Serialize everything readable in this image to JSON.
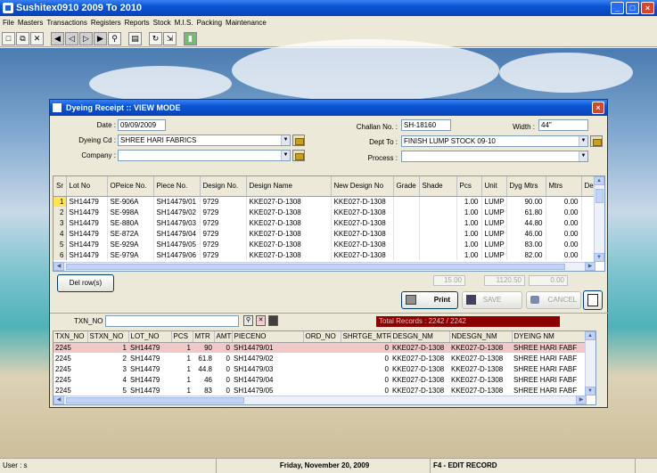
{
  "app": {
    "title": "Sushitex0910     2009  To  2010",
    "menus": [
      "File",
      "Masters",
      "Transactions",
      "Registers",
      "Reports",
      "Stock",
      "M.I.S.",
      "Packing",
      "Maintenance"
    ]
  },
  "toolbar": [
    "new-icon",
    "copy-icon",
    "delete-icon",
    "first-record-icon",
    "prev-record-icon",
    "next-record-icon",
    "last-record-icon",
    "search-icon",
    "print-icon",
    "refresh-icon",
    "export-icon",
    "exit-icon"
  ],
  "dialog": {
    "title": "Dyeing Receipt :: VIEW MODE",
    "date_label": "Date :",
    "date_value": "09/09/2009",
    "dyeing_cd_label": "Dyeing Cd :",
    "dyeing_cd_value": "SHREE HARI FABRICS",
    "company_label": "Company :",
    "company_value": "",
    "challan_label": "Challan No. :",
    "challan_value": "SH-18160",
    "width_label": "Width :",
    "width_value": "44\"",
    "dept_label": "Dept To :",
    "dept_value": "FINISH LUMP STOCK 09-10",
    "process_label": "Process :",
    "process_value": ""
  },
  "grid1": {
    "columns": [
      "Sr",
      "Lot No",
      "OPeice No.",
      "Piece No.",
      "Design No.",
      "Design Name",
      "New Design No",
      "Grade",
      "Shade",
      "Pcs",
      "Unit",
      "Dyg Mtrs",
      "Mtrs",
      "De"
    ],
    "rows": [
      [
        "1",
        "SH14479",
        "SE-906A",
        "SH14479/01",
        "9729",
        "KKE027-D-1308",
        "KKE027-D-1308",
        "",
        "",
        "1.00",
        "LUMP",
        "90.00",
        "0.00",
        ""
      ],
      [
        "2",
        "SH14479",
        "SE-998A",
        "SH14479/02",
        "9729",
        "KKE027-D-1308",
        "KKE027-D-1308",
        "",
        "",
        "1.00",
        "LUMP",
        "61.80",
        "0.00",
        ""
      ],
      [
        "3",
        "SH14479",
        "SE-880A",
        "SH14479/03",
        "9729",
        "KKE027-D-1308",
        "KKE027-D-1308",
        "",
        "",
        "1.00",
        "LUMP",
        "44.80",
        "0.00",
        ""
      ],
      [
        "4",
        "SH14479",
        "SE-872A",
        "SH14479/04",
        "9729",
        "KKE027-D-1308",
        "KKE027-D-1308",
        "",
        "",
        "1.00",
        "LUMP",
        "46.00",
        "0.00",
        ""
      ],
      [
        "5",
        "SH14479",
        "SE-929A",
        "SH14479/05",
        "9729",
        "KKE027-D-1308",
        "KKE027-D-1308",
        "",
        "",
        "1.00",
        "LUMP",
        "83.00",
        "0.00",
        ""
      ],
      [
        "6",
        "SH14479",
        "SE-979A",
        "SH14479/06",
        "9729",
        "KKE027-D-1308",
        "KKE027-D-1308",
        "",
        "",
        "1.00",
        "LUMP",
        "82.00",
        "0.00",
        ""
      ]
    ]
  },
  "totals": {
    "pcs": "15.00",
    "dyg_mtrs": "1120.50",
    "mtrs": "0.00"
  },
  "buttons": {
    "del_rows": "Del row(s)",
    "print": "Print",
    "save": "SAVE",
    "cancel": "CANCEL"
  },
  "search": {
    "label": "TXN_NO",
    "value": "",
    "total_records": "Total Records : 2242 / 2242"
  },
  "grid2": {
    "columns": [
      "TXN_NO",
      "STXN_NO",
      "LOT_NO",
      "PCS",
      "MTR",
      "AMT",
      "PIECENO",
      "ORD_NO",
      "SHRTGE_MTR",
      "DESGN_NM",
      "NDESGN_NM",
      "DYEING NM"
    ],
    "rows": [
      [
        "2245",
        "1",
        "SH14479",
        "1",
        "90",
        "0",
        "SH14479/01",
        "",
        "0",
        "KKE027-D-1308",
        "KKE027-D-1308",
        "SHREE HARI FABF"
      ],
      [
        "2245",
        "2",
        "SH14479",
        "1",
        "61.8",
        "0",
        "SH14479/02",
        "",
        "0",
        "KKE027-D-1308",
        "KKE027-D-1308",
        "SHREE HARI FABF"
      ],
      [
        "2245",
        "3",
        "SH14479",
        "1",
        "44.8",
        "0",
        "SH14479/03",
        "",
        "0",
        "KKE027-D-1308",
        "KKE027-D-1308",
        "SHREE HARI FABF"
      ],
      [
        "2245",
        "4",
        "SH14479",
        "1",
        "46",
        "0",
        "SH14479/04",
        "",
        "0",
        "KKE027-D-1308",
        "KKE027-D-1308",
        "SHREE HARI FABF"
      ],
      [
        "2245",
        "5",
        "SH14479",
        "1",
        "83",
        "0",
        "SH14479/05",
        "",
        "0",
        "KKE027-D-1308",
        "KKE027-D-1308",
        "SHREE HARI FABF"
      ]
    ]
  },
  "status": {
    "user": "User : s",
    "date": "Friday, November 20, 2009",
    "hint": "F4 - EDIT RECORD"
  },
  "colors": {
    "title_bar": "#0a55d4",
    "selected_sr": "#ffe650",
    "total_records_bg": "#8b0000",
    "highlight_row": "#f0c8c8"
  }
}
